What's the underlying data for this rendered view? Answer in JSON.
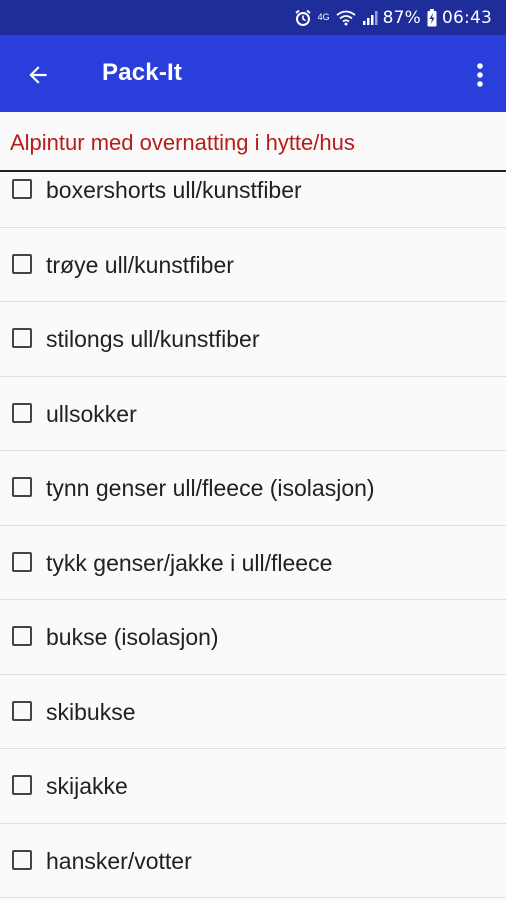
{
  "status_bar": {
    "network_label": "4G",
    "battery_percent": "87%",
    "time": "06:43",
    "icons": [
      "alarm-icon",
      "network-4g-icon",
      "wifi-icon",
      "signal-icon",
      "battery-charging-icon"
    ]
  },
  "app_bar": {
    "title": "Pack-It",
    "back_icon": "arrow-back-icon",
    "menu_icon": "more-vertical-icon",
    "background": "#2a3edb"
  },
  "list": {
    "header": "Alpintur med overnatting i hytte/hus",
    "header_color": "#b71c1c",
    "items": [
      {
        "label": "boxershorts ull/kunstfiber",
        "checked": false
      },
      {
        "label": "trøye ull/kunstfiber",
        "checked": false
      },
      {
        "label": "stilongs ull/kunstfiber",
        "checked": false
      },
      {
        "label": "ullsokker",
        "checked": false
      },
      {
        "label": "tynn genser ull/fleece (isolasjon)",
        "checked": false
      },
      {
        "label": "tykk genser/jakke i ull/fleece",
        "checked": false
      },
      {
        "label": "bukse (isolasjon)",
        "checked": false
      },
      {
        "label": "skibukse",
        "checked": false
      },
      {
        "label": "skijakke",
        "checked": false
      },
      {
        "label": "hansker/votter",
        "checked": false
      }
    ]
  }
}
